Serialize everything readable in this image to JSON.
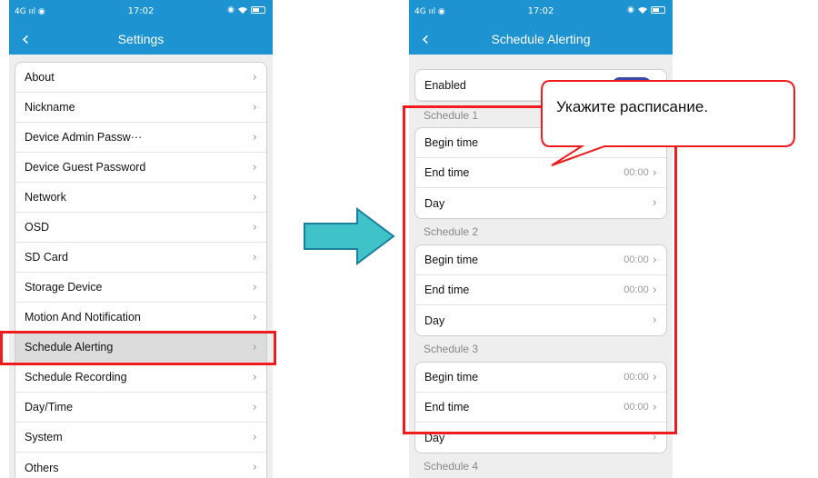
{
  "status_bar": {
    "signal": "4G",
    "time": "17:02"
  },
  "left_screen": {
    "title": "Settings",
    "items": [
      {
        "label": "About"
      },
      {
        "label": "Nickname"
      },
      {
        "label": "Device Admin Passw···"
      },
      {
        "label": "Device Guest Password"
      },
      {
        "label": "Network"
      },
      {
        "label": "OSD"
      },
      {
        "label": "SD Card"
      },
      {
        "label": "Storage Device"
      },
      {
        "label": "Motion And Notification"
      },
      {
        "label": "Schedule Alerting",
        "highlighted": true
      },
      {
        "label": "Schedule Recording"
      },
      {
        "label": "Day/Time"
      },
      {
        "label": "System"
      },
      {
        "label": "Others"
      }
    ]
  },
  "right_screen": {
    "title": "Schedule Alerting",
    "enabled_label": "Enabled",
    "schedules": [
      {
        "title": "Schedule 1",
        "begin_label": "Begin time",
        "begin_value": "",
        "end_label": "End time",
        "end_value": "00:00",
        "day_label": "Day"
      },
      {
        "title": "Schedule 2",
        "begin_label": "Begin time",
        "begin_value": "00:00",
        "end_label": "End time",
        "end_value": "00:00",
        "day_label": "Day"
      },
      {
        "title": "Schedule 3",
        "begin_label": "Begin time",
        "begin_value": "00:00",
        "end_label": "End time",
        "end_value": "00:00",
        "day_label": "Day"
      }
    ],
    "next_section_partial": "Schedule 4"
  },
  "callout": {
    "text": "Укажите расписание."
  },
  "colors": {
    "header": "#1d93d1",
    "highlight_border": "#ee1c1c",
    "arrow_fill": "#3fc3c8",
    "toggle": "#3a49a8"
  },
  "icons": {
    "back": "chevron-left-icon",
    "row": "chevron-right-icon"
  }
}
